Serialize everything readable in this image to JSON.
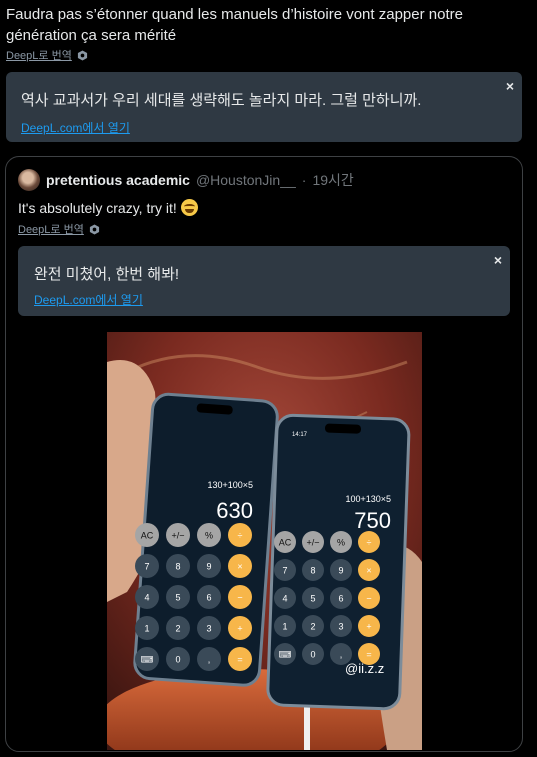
{
  "tweet": {
    "text": "Faudra pas s’étonner quand les manuels d’histoire vont zapper notre génération ça sera mérité",
    "translate_label": "DeepL로 번역",
    "translation": "역사 교과서가 우리 세대를 생략해도 놀라지 마라. 그럴 만하니까.",
    "open_link": "DeepL.com에서 열기",
    "close": "×"
  },
  "quote": {
    "name": "pretentious academic",
    "handle": "@HoustonJin__",
    "dot": "·",
    "time": "19시간",
    "text": "It's absolutely crazy, try it!",
    "translate_label": "DeepL로 번역",
    "translation": "완전 미쳤어, 한번 해봐!",
    "open_link": "DeepL.com에서 열기",
    "close": "×"
  },
  "media": {
    "left_phone": {
      "time": "",
      "expression": "130+100×5",
      "result": "630"
    },
    "right_phone": {
      "time": "14:17",
      "expression": "100+130×5",
      "result": "750"
    },
    "keypad": [
      "AC",
      "+/−",
      "%",
      "÷",
      "7",
      "8",
      "9",
      "×",
      "4",
      "5",
      "6",
      "−",
      "1",
      "2",
      "3",
      "+",
      "⌨",
      "0",
      ",",
      "="
    ],
    "watermark": "@ii.z.z"
  },
  "colors": {
    "background": "#000000",
    "translation_box": "#2f3943",
    "link_blue": "#1d9bf0",
    "muted": "#71767b",
    "calc_orange": "#f7b64a",
    "calc_gray": "#a5a5a5"
  }
}
